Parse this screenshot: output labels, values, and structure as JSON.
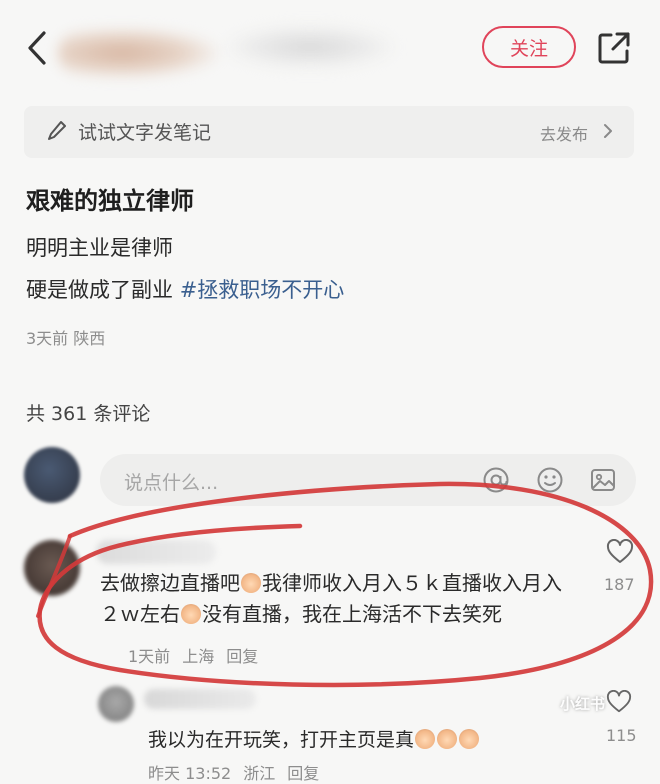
{
  "header": {
    "follow_label": "关注",
    "icons": {
      "back": "chevron-left-icon",
      "share": "share-icon"
    }
  },
  "draft": {
    "label": "试试文字发笔记",
    "action": "去发布"
  },
  "post": {
    "title": "艰难的独立律师",
    "lines": [
      "明明主业是律师",
      "硬是做成了副业"
    ],
    "hashtag": "#拯救职场不开心",
    "time": "3天前",
    "location": "陕西"
  },
  "comments_section": {
    "count_label": "共 361 条评论",
    "input_placeholder": "说点什么..."
  },
  "comments": [
    {
      "text_a": "去做擦边直播吧",
      "text_b": "我律师收入月入５ｋ直播收入月入２ｗ左右",
      "text_c": "没有直播，我在上海活不下去笑死",
      "time": "1天前",
      "location": "上海",
      "reply_label": "回复",
      "likes": "187"
    },
    {
      "text": "我以为在开玩笑，打开主页是真",
      "time": "昨天 13:52",
      "location": "浙江",
      "reply_label": "回复",
      "likes": "115"
    }
  ],
  "watermark": {
    "label": "小红书"
  },
  "annotation_color": "#d23a3a",
  "accent": "#e0445a"
}
